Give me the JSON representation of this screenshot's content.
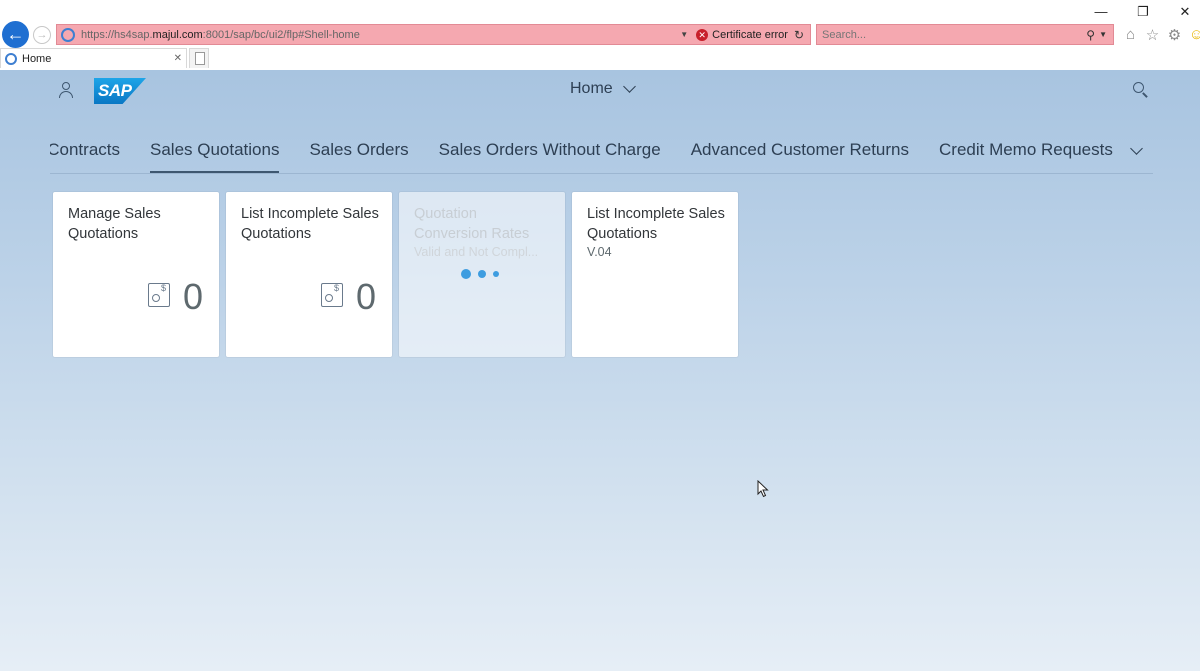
{
  "browser": {
    "url_prefix": "https://hs4sap.",
    "url_host": "majul.com",
    "url_rest": ":8001/sap/bc/ui2/flp#Shell-home",
    "cert_error": "Certificate error",
    "search_placeholder": "Search...",
    "tab_label": "Home",
    "colors": {
      "error_bar": "#f5a8b0",
      "back_button": "#1f6fd1"
    }
  },
  "shell": {
    "logo_text": "SAP",
    "title": "Home",
    "colors": {
      "accent": "#3e9de0",
      "text": "#2d3f53"
    }
  },
  "anchor_nav": {
    "items": [
      {
        "label": "Sales Contracts",
        "selected": false
      },
      {
        "label": "Sales Quotations",
        "selected": true
      },
      {
        "label": "Sales Orders",
        "selected": false
      },
      {
        "label": "Sales Orders Without Charge",
        "selected": false
      },
      {
        "label": "Advanced Customer Returns",
        "selected": false
      },
      {
        "label": "Credit Memo Requests",
        "selected": false
      }
    ]
  },
  "tiles": [
    {
      "title": "Manage Sales Quotations",
      "subtitle": "",
      "number": "0",
      "icon": "quotation-icon",
      "loading": false
    },
    {
      "title": "List Incomplete Sales Quotations",
      "subtitle": "",
      "number": "0",
      "icon": "quotation-icon",
      "loading": false
    },
    {
      "title": "Quotation Conversion Rates",
      "subtitle": "Valid and Not Compl...",
      "number": "",
      "icon": "",
      "loading": true
    },
    {
      "title": "List Incomplete Sales Quotations",
      "subtitle": "V.04",
      "number": "",
      "icon": "",
      "loading": false
    }
  ]
}
